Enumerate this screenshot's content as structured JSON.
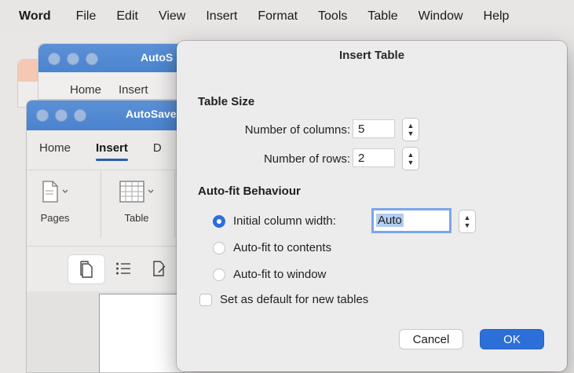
{
  "menubar": {
    "items": [
      "Word",
      "File",
      "Edit",
      "View",
      "Insert",
      "Format",
      "Tools",
      "Table",
      "Window",
      "Help"
    ]
  },
  "back_window": {
    "title": "AutoS",
    "tabs": [
      "Home",
      "Insert"
    ]
  },
  "front_window": {
    "title": "AutoSave",
    "tabs": [
      "Home",
      "Insert",
      "D"
    ],
    "ribbon": {
      "pages_label": "Pages",
      "table_label": "Table"
    }
  },
  "dialog": {
    "title": "Insert Table",
    "table_size": {
      "heading": "Table Size",
      "columns_label": "Number of columns:",
      "columns_value": "5",
      "rows_label": "Number of rows:",
      "rows_value": "2"
    },
    "autofit": {
      "heading": "Auto-fit Behaviour",
      "initial_width_label": "Initial column width:",
      "initial_width_value": "Auto",
      "contents_label": "Auto-fit to contents",
      "window_label": "Auto-fit to window"
    },
    "default_label": "Set as default for new tables",
    "cancel_label": "Cancel",
    "ok_label": "OK"
  },
  "colors": {
    "accent": "#2c6fd9",
    "titlebar": "#4b84cf"
  }
}
